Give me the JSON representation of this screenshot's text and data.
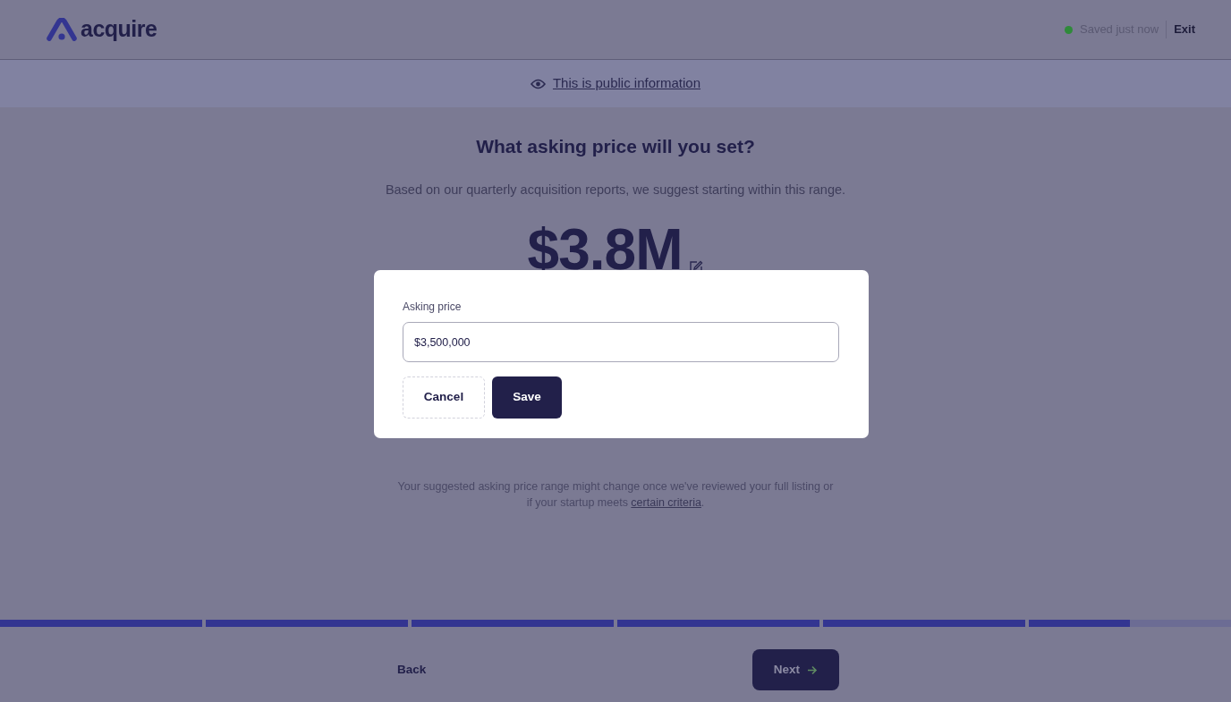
{
  "header": {
    "logo_text": "acquire",
    "save_status": "Saved just now",
    "exit_label": "Exit"
  },
  "banner": {
    "text": "This is public information"
  },
  "question": {
    "title": "What asking price will you set?",
    "subtitle": "Based on our quarterly acquisition reports, we suggest starting within this range.",
    "price": "$3.8M"
  },
  "note": {
    "text": "Your suggested asking price range might change once we've reviewed your full listing or if your startup meets",
    "link": "certain criteria",
    "end": "."
  },
  "dialog": {
    "label": "Asking price",
    "value": "$3,500,000",
    "buttons": [
      {
        "kind": "secondary",
        "label": "Cancel"
      },
      {
        "kind": "primary",
        "label": "Save"
      }
    ]
  },
  "progress": [
    {
      "level": 1
    },
    {
      "level": 1
    },
    {
      "level": 1
    },
    {
      "level": 1
    },
    {
      "level": 1
    },
    {
      "level": 0.5
    }
  ],
  "footer": {
    "back_label": "Back",
    "next_label": "Next"
  }
}
